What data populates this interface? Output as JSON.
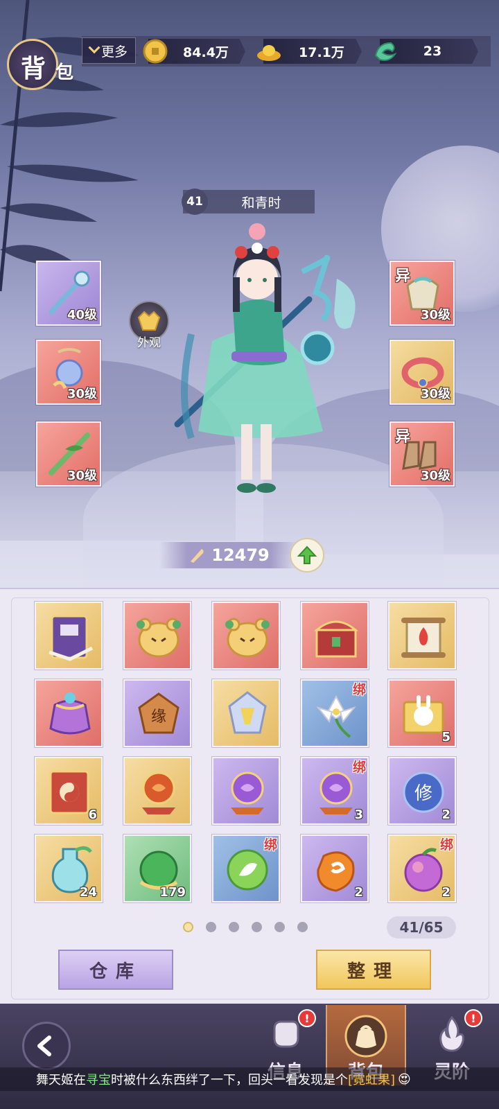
{
  "header": {
    "title_char1": "背",
    "title_char2": "包",
    "more_label": "更多",
    "currencies": [
      {
        "icon": "copper-coin-icon",
        "value": "84.4万"
      },
      {
        "icon": "gold-ingot-icon",
        "value": "17.1万"
      },
      {
        "icon": "jade-icon",
        "value": "23"
      }
    ]
  },
  "character": {
    "level": "41",
    "name": "和青时",
    "appearance_label": "外观",
    "power": "12479"
  },
  "equipment": {
    "left": [
      {
        "icon": "staff-icon",
        "level": "40级",
        "rarity": "purple",
        "tag": ""
      },
      {
        "icon": "charm-pendant-icon",
        "level": "30级",
        "rarity": "red",
        "tag": ""
      },
      {
        "icon": "flute-icon",
        "level": "30级",
        "rarity": "red",
        "tag": ""
      }
    ],
    "right": [
      {
        "icon": "shoulder-armor-icon",
        "level": "30级",
        "rarity": "red",
        "tag": "异"
      },
      {
        "icon": "bracelet-icon",
        "level": "30级",
        "rarity": "gold",
        "tag": ""
      },
      {
        "icon": "boots-icon",
        "level": "30级",
        "rarity": "red",
        "tag": "异"
      }
    ]
  },
  "inventory": {
    "items": [
      {
        "icon": "spellbook-icon",
        "rarity": "gold",
        "count": "",
        "bind": ""
      },
      {
        "icon": "bear-bun-icon",
        "rarity": "red",
        "count": "",
        "bind": ""
      },
      {
        "icon": "bear-bun-icon",
        "rarity": "red",
        "count": "",
        "bind": ""
      },
      {
        "icon": "treasure-chest-icon",
        "rarity": "red",
        "count": "",
        "bind": ""
      },
      {
        "icon": "scroll-icon",
        "rarity": "gold",
        "count": "",
        "bind": ""
      },
      {
        "icon": "lucky-bag-icon",
        "rarity": "red",
        "count": "",
        "bind": ""
      },
      {
        "icon": "fate-token-icon",
        "rarity": "purple",
        "count": "",
        "bind": ""
      },
      {
        "icon": "crystal-stone-icon",
        "rarity": "gold",
        "count": "",
        "bind": ""
      },
      {
        "icon": "lily-flower-icon",
        "rarity": "blue",
        "count": "",
        "bind": "绑"
      },
      {
        "icon": "rabbit-puzzle-icon",
        "rarity": "red",
        "count": "5",
        "bind": ""
      },
      {
        "icon": "taiji-book-icon",
        "rarity": "gold",
        "count": "6",
        "bind": ""
      },
      {
        "icon": "red-orb-icon",
        "rarity": "gold",
        "count": "",
        "bind": ""
      },
      {
        "icon": "purple-orb-icon",
        "rarity": "purple",
        "count": "",
        "bind": ""
      },
      {
        "icon": "purple-orb-icon",
        "rarity": "purple",
        "count": "3",
        "bind": "绑"
      },
      {
        "icon": "cultivation-orb-icon",
        "rarity": "purple",
        "count": "2",
        "bind": ""
      },
      {
        "icon": "potion-bottle-icon",
        "rarity": "gold",
        "count": "24",
        "bind": ""
      },
      {
        "icon": "green-pearl-icon",
        "rarity": "green",
        "count": "179",
        "bind": ""
      },
      {
        "icon": "leaf-orb-icon",
        "rarity": "blue",
        "count": "",
        "bind": "绑"
      },
      {
        "icon": "amber-stone-icon",
        "rarity": "purple",
        "count": "2",
        "bind": ""
      },
      {
        "icon": "rainbow-fruit-icon",
        "rarity": "gold",
        "count": "2",
        "bind": "绑"
      }
    ],
    "page_count": 6,
    "current_page": 1,
    "capacity": "41/65",
    "warehouse_label": "仓库",
    "sort_label": "整理"
  },
  "nav": {
    "tabs": [
      {
        "icon": "fist-icon",
        "label": "信息",
        "alert": "!"
      },
      {
        "icon": "bag-icon",
        "label": "背包",
        "alert": ""
      },
      {
        "icon": "spirit-flame-icon",
        "label": "灵阶",
        "alert": "!"
      }
    ]
  },
  "ticker": {
    "part1": "舞天姬在",
    "part2": "寻宝",
    "part3": "时被什么东西绊了一下，回头一看发现是个",
    "part4": "[霓虹果]"
  },
  "colors": {
    "gold_slot": "#e5bb66",
    "red_slot": "#df6e69",
    "purple_slot": "#a18ad6",
    "blue_slot": "#6f93cb",
    "green_slot": "#6fbb7d",
    "bind_red": "#e0393a"
  }
}
